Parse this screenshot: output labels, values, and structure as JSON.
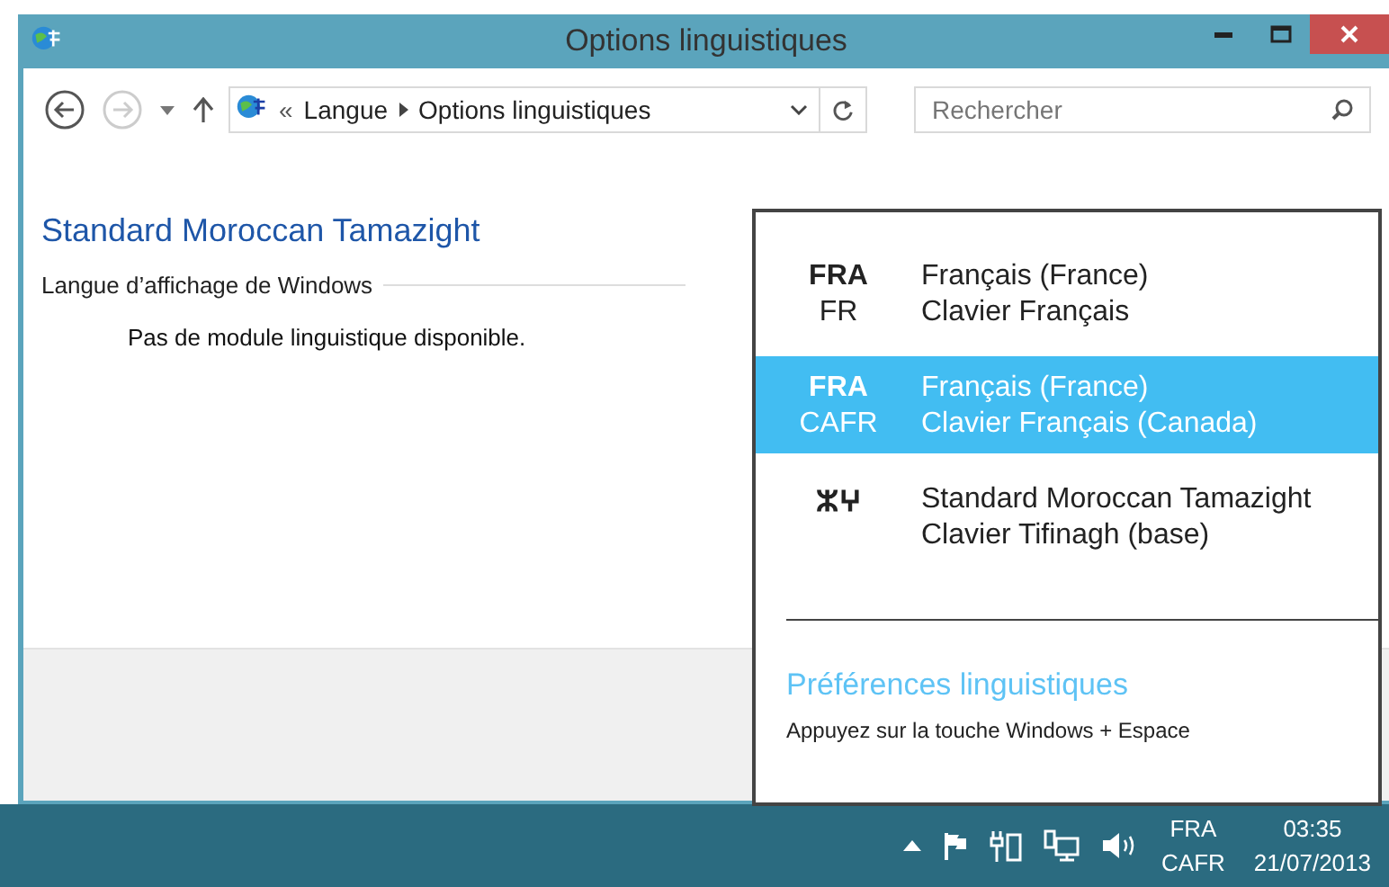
{
  "window": {
    "title": "Options linguistiques"
  },
  "address_bar": {
    "breadcrumbs": [
      "Langue",
      "Options linguistiques"
    ],
    "prefix": "«"
  },
  "search": {
    "placeholder": "Rechercher"
  },
  "content": {
    "heading": "Standard Moroccan Tamazight",
    "section": "Langue d’affichage de Windows",
    "message": "Pas de module linguistique disponible."
  },
  "flyout": {
    "items": [
      {
        "code": "FRA",
        "layout_code": "FR",
        "language": "Français (France)",
        "keyboard": "Clavier Français",
        "selected": false
      },
      {
        "code": "FRA",
        "layout_code": "CAFR",
        "language": "Français (France)",
        "keyboard": "Clavier Français (Canada)",
        "selected": true
      },
      {
        "code": "ⵣⵖ",
        "language": "Standard Moroccan Tamazight",
        "keyboard": "Clavier Tifinagh (base)",
        "selected": false
      }
    ],
    "link": "Préférences linguistiques",
    "hint": "Appuyez sur la touche Windows + Espace"
  },
  "taskbar": {
    "language": "FRA",
    "layout": "CAFR",
    "time": "03:35",
    "date": "21/07/2013"
  }
}
